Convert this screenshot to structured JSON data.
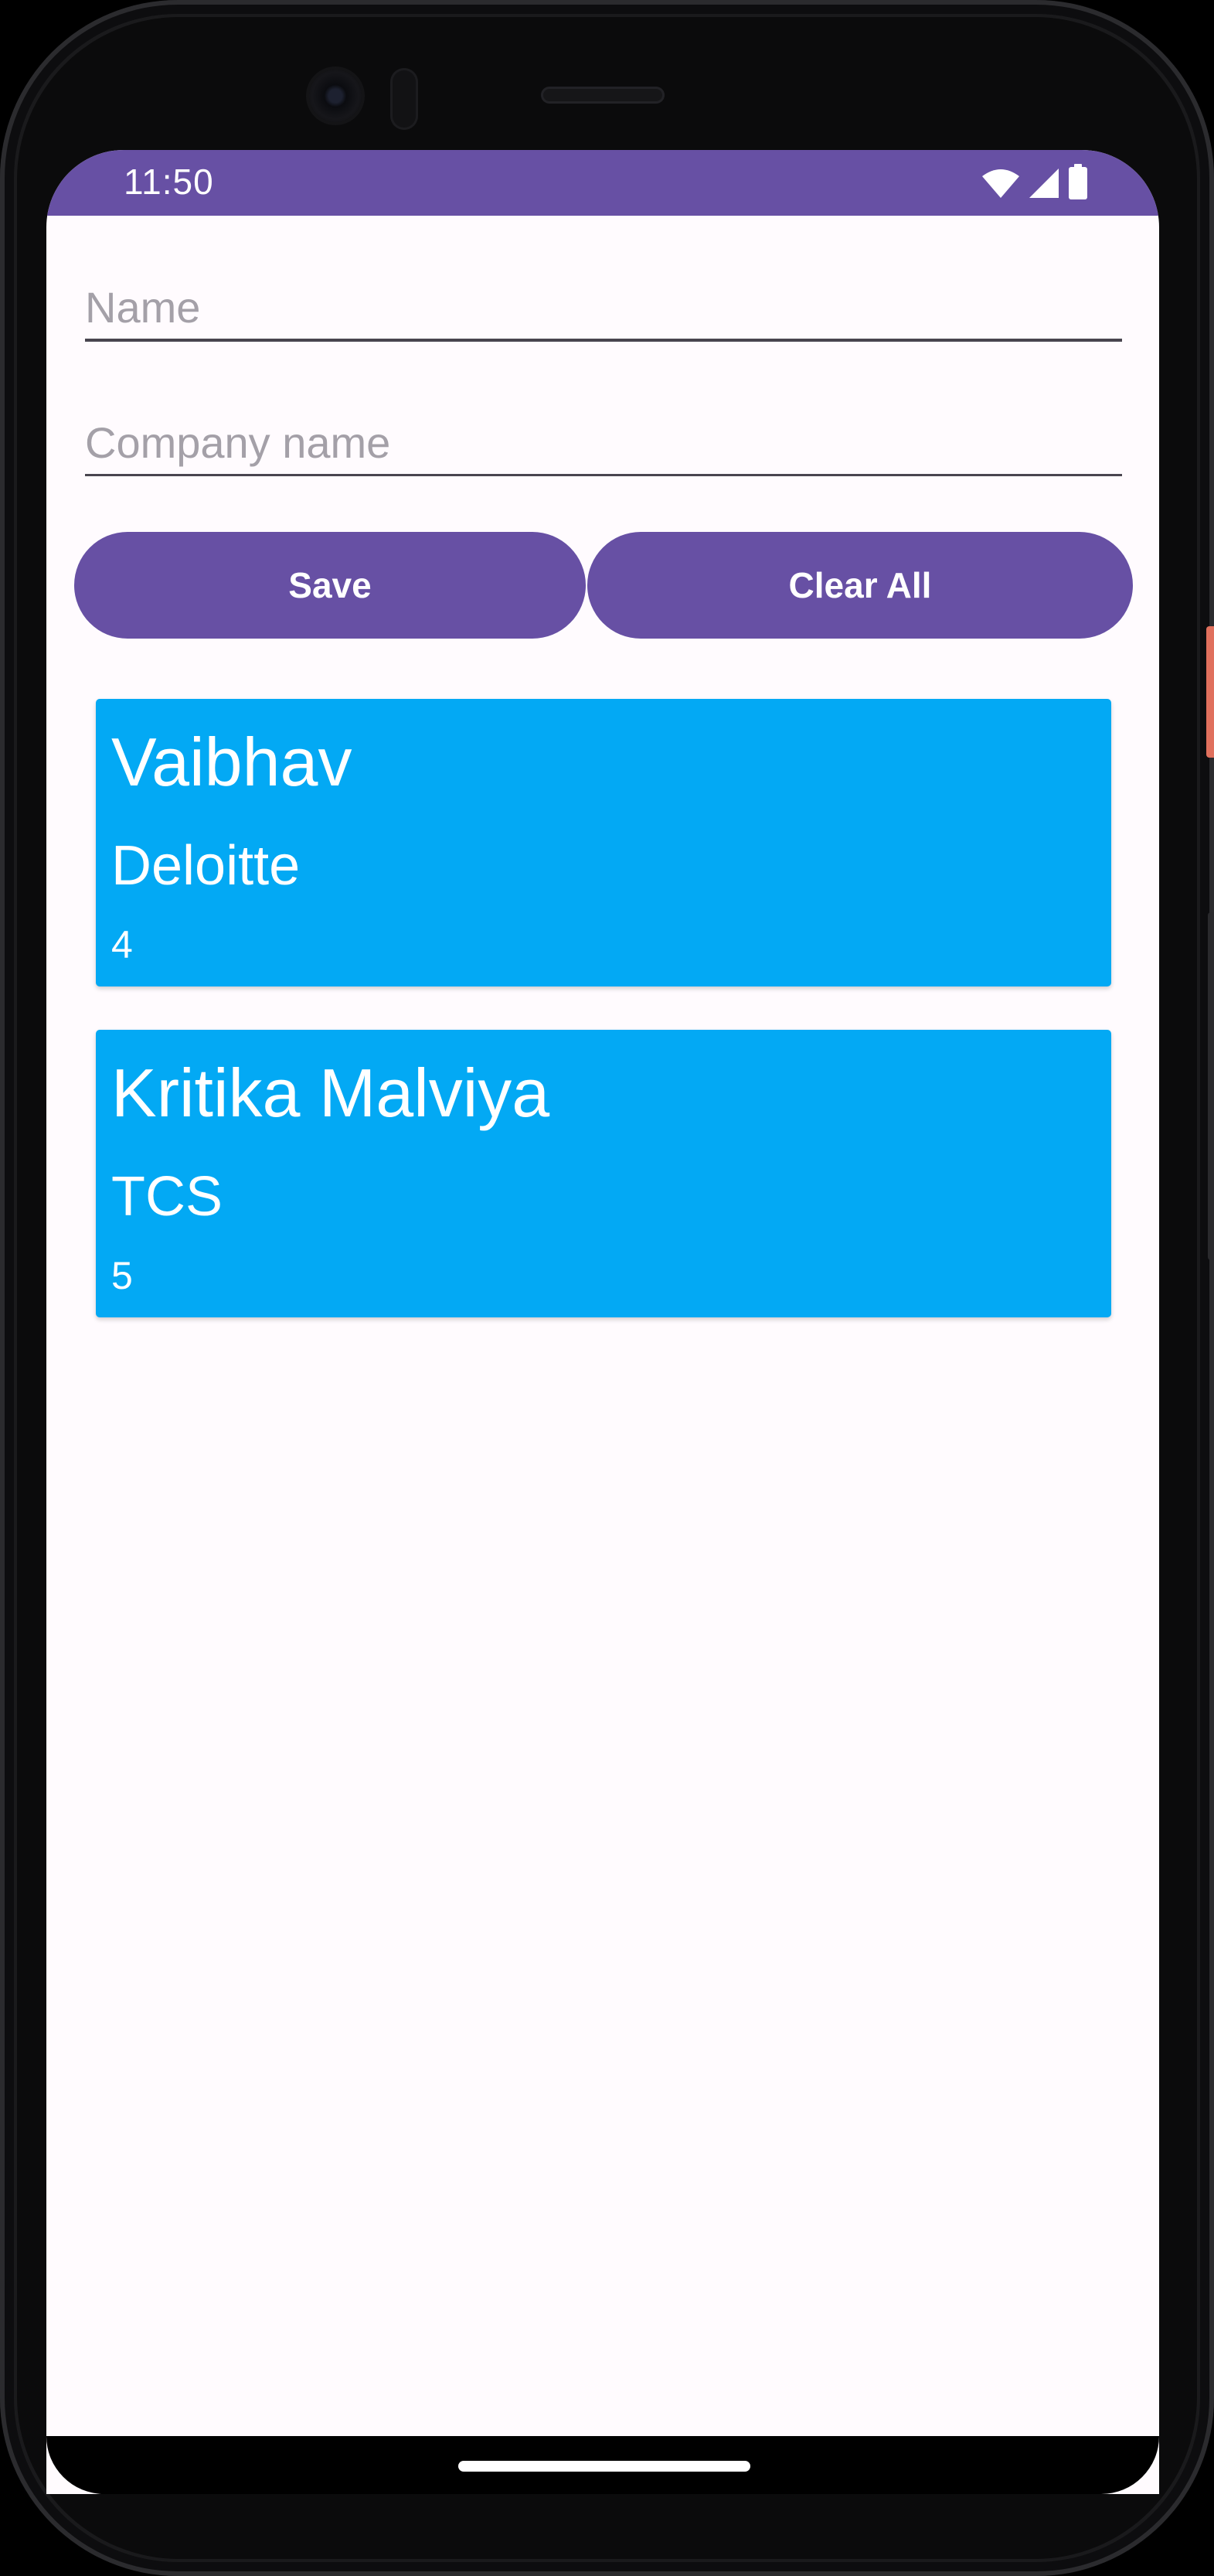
{
  "status_bar": {
    "time": "11:50",
    "icons": [
      "wifi-icon",
      "signal-icon",
      "battery-icon"
    ],
    "color": "#6750a4"
  },
  "form": {
    "name_placeholder": "Name",
    "name_value": "",
    "company_placeholder": "Company name",
    "company_value": ""
  },
  "buttons": {
    "save_label": "Save",
    "clear_label": "Clear All",
    "color": "#6750a4"
  },
  "records": [
    {
      "name": "Vaibhav",
      "company": "Deloitte",
      "id": "4"
    },
    {
      "name": "Kritika Malviya",
      "company": "TCS",
      "id": "5"
    }
  ],
  "card_color": "#03a9f4"
}
